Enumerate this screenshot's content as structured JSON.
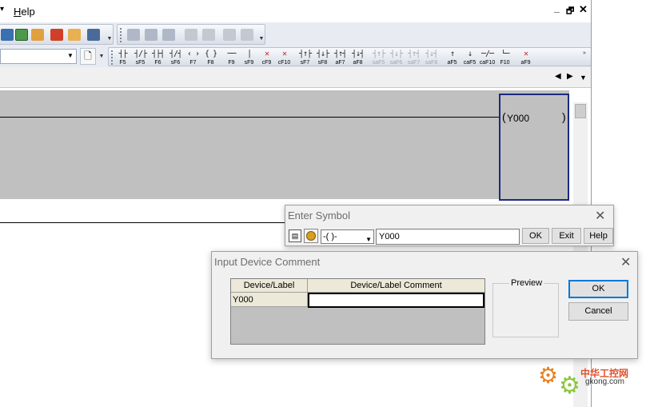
{
  "menubar": {
    "help_label": "Help"
  },
  "mdi_controls": {
    "minimize": "_",
    "restore": "🗗",
    "close": "✕"
  },
  "toolbar2": {
    "combo_value": "",
    "ladder_buttons": [
      {
        "symbol": "┤├",
        "key": "F5",
        "disabled": false
      },
      {
        "symbol": "┤/├",
        "key": "sF5",
        "disabled": false
      },
      {
        "symbol": "┤├┤",
        "key": "F6",
        "disabled": false
      },
      {
        "symbol": "┤/┤",
        "key": "sF6",
        "disabled": false
      },
      {
        "symbol": "‹ ›",
        "key": "F7",
        "disabled": false
      },
      {
        "symbol": "{ }",
        "key": "F8",
        "disabled": false
      },
      {
        "symbol": "──",
        "key": "F9",
        "disabled": false
      },
      {
        "symbol": "│",
        "key": "sF9",
        "disabled": false
      },
      {
        "symbol": "✕",
        "key": "cF9",
        "disabled": false
      },
      {
        "symbol": "✕",
        "key": "cF10",
        "disabled": false
      },
      {
        "symbol": "┤↑├",
        "key": "sF7",
        "disabled": false
      },
      {
        "symbol": "┤↓├",
        "key": "sF8",
        "disabled": false
      },
      {
        "symbol": "┤↑┤",
        "key": "aF7",
        "disabled": false
      },
      {
        "symbol": "┤↓┤",
        "key": "aF8",
        "disabled": false
      },
      {
        "symbol": "┤↑├",
        "key": "saF5",
        "disabled": true
      },
      {
        "symbol": "┤↓├",
        "key": "saF6",
        "disabled": true
      },
      {
        "symbol": "┤↑┤",
        "key": "saF7",
        "disabled": true
      },
      {
        "symbol": "┤↓┤",
        "key": "saF8",
        "disabled": true
      },
      {
        "symbol": "↑",
        "key": "aF5",
        "disabled": false
      },
      {
        "symbol": "↓",
        "key": "caF5",
        "disabled": false
      },
      {
        "symbol": "─/─",
        "key": "caF10",
        "disabled": false
      },
      {
        "symbol": "└─",
        "key": "F10",
        "disabled": false
      },
      {
        "symbol": "✕",
        "key": "aF9",
        "disabled": false
      }
    ]
  },
  "tabbar": {
    "prev": "◀",
    "next": "▶",
    "dropdown": "▼"
  },
  "ladder": {
    "coil_left": "(",
    "coil_label": "Y000",
    "coil_right": ")"
  },
  "enter_symbol": {
    "title": "Enter Symbol",
    "close": "✕",
    "instruction_select": "-( )-",
    "device_value": "Y000",
    "ok_label": "OK",
    "exit_label": "Exit",
    "help_label": "Help"
  },
  "device_comment": {
    "title": "Input Device Comment",
    "close": "✕",
    "col_device": "Device/Label",
    "col_comment": "Device/Label Comment",
    "row_device": "Y000",
    "row_comment": "",
    "preview_label": "Preview",
    "ok_label": "OK",
    "cancel_label": "Cancel"
  },
  "watermark": {
    "cn_text": "中华工控网",
    "url_text": "gkong.com"
  },
  "colors": {
    "rung_background": "#c0c0c0",
    "cursor_border": "#1a2a80",
    "default_button_border": "#0078d7",
    "watermark_orange": "#e8801c",
    "watermark_green": "#8cc63e"
  }
}
